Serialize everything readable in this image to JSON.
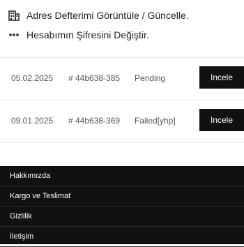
{
  "account_menu": {
    "items": [
      {
        "label": "Adres Defterimi Görüntüle / Güncelle.",
        "icon": "building-icon"
      },
      {
        "label": "Hesabımın Şifresini Değiştir.",
        "icon": "dots-icon"
      }
    ]
  },
  "orders": {
    "rows": [
      {
        "date": "05.02.2025",
        "order_no": "# 44b638-385",
        "status": "Pending",
        "action": "Incele"
      },
      {
        "date": "09.01.2025",
        "order_no": "# 44b638-369",
        "status": "Failed[yhp]",
        "action": "Incele"
      }
    ]
  },
  "footer": {
    "links": [
      "Hakkımızda",
      "Kargo ve Teslimat",
      "Gizlilik",
      "İletişim"
    ]
  },
  "colors": {
    "dark": "#111111",
    "text": "#222222",
    "muted": "#555555"
  }
}
